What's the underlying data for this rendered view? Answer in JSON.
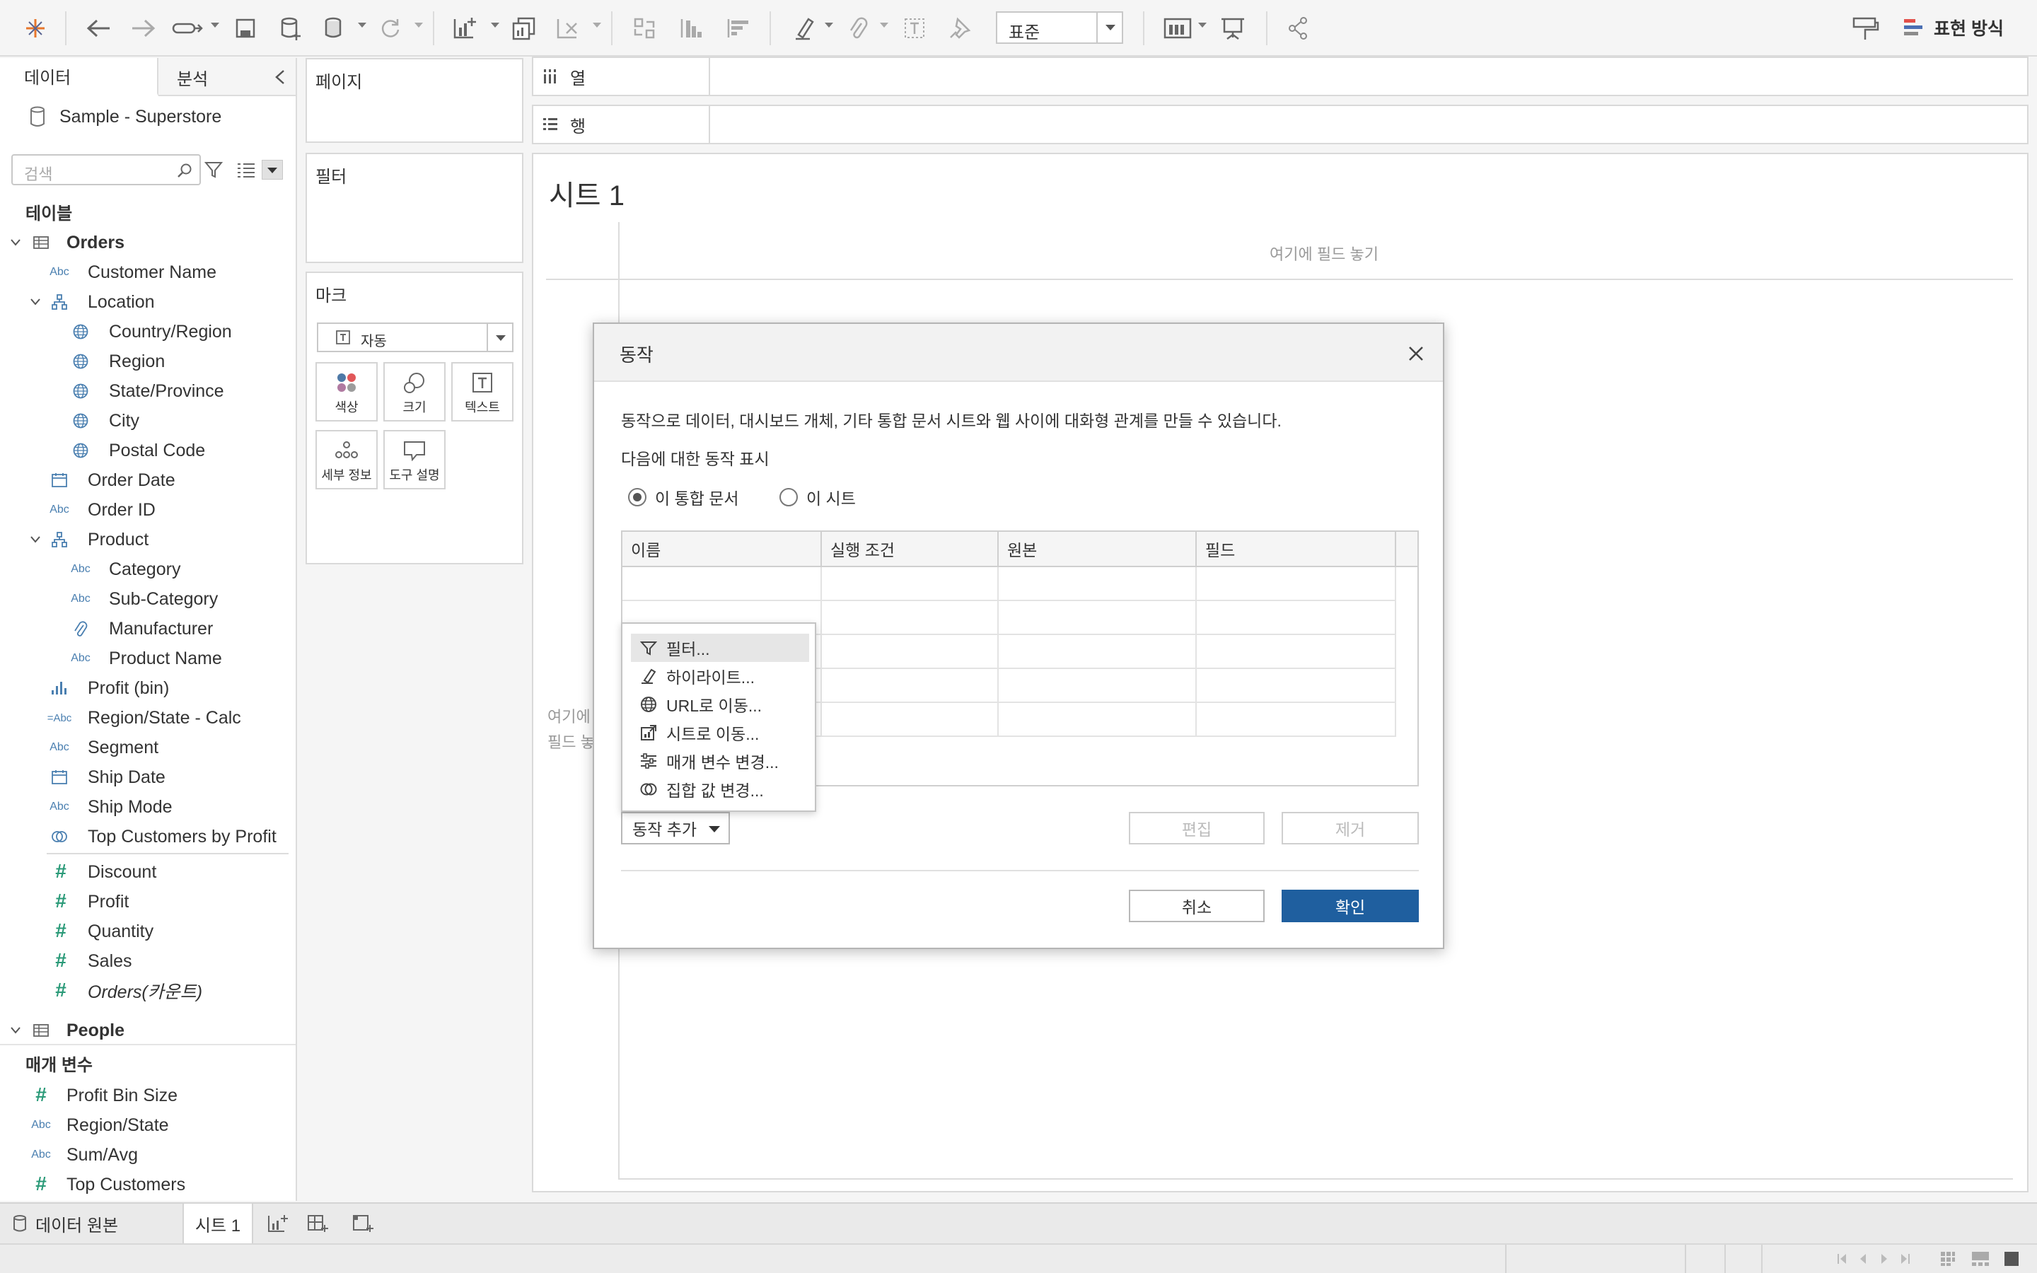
{
  "toolbar": {
    "fit_label": "표준",
    "show_me_label": "표현 방식"
  },
  "left_pane": {
    "tabs": [
      "데이터",
      "분석"
    ],
    "datasource": "Sample - Superstore",
    "search_placeholder": "검색",
    "tables_header": "테이블",
    "orders_table": "Orders",
    "fields": [
      {
        "label": "Customer Name",
        "icon": "Abc"
      },
      {
        "label": "Location",
        "icon": "hierarchy"
      },
      {
        "label": "Country/Region",
        "icon": "globe"
      },
      {
        "label": "Region",
        "icon": "globe"
      },
      {
        "label": "State/Province",
        "icon": "globe"
      },
      {
        "label": "City",
        "icon": "globe"
      },
      {
        "label": "Postal Code",
        "icon": "globe"
      },
      {
        "label": "Order Date",
        "icon": "calendar"
      },
      {
        "label": "Order ID",
        "icon": "Abc"
      },
      {
        "label": "Product",
        "icon": "hierarchy"
      },
      {
        "label": "Category",
        "icon": "Abc"
      },
      {
        "label": "Sub-Category",
        "icon": "Abc"
      },
      {
        "label": "Manufacturer",
        "icon": "paperclip"
      },
      {
        "label": "Product Name",
        "icon": "Abc"
      },
      {
        "label": "Profit (bin)",
        "icon": "bin"
      },
      {
        "label": "Region/State - Calc",
        "icon": "=Abc"
      },
      {
        "label": "Segment",
        "icon": "Abc"
      },
      {
        "label": "Ship Date",
        "icon": "calendar"
      },
      {
        "label": "Ship Mode",
        "icon": "Abc"
      },
      {
        "label": "Top Customers by Profit",
        "icon": "set"
      }
    ],
    "measures": [
      "Discount",
      "Profit",
      "Quantity",
      "Sales",
      "Orders(카운트)"
    ],
    "people_table": "People",
    "params_header": "매개 변수",
    "params": [
      {
        "label": "Profit Bin Size",
        "icon": "#"
      },
      {
        "label": "Region/State",
        "icon": "Abc"
      },
      {
        "label": "Sum/Avg",
        "icon": "Abc"
      },
      {
        "label": "Top Customers",
        "icon": "#"
      }
    ],
    "abc_text": "Abc",
    "calc_abc_text": "=Abc",
    "hash_text": "#"
  },
  "cards": {
    "pages": "페이지",
    "filters": "필터",
    "marks": "마크",
    "marks_type": "자동",
    "mark_buttons": [
      "색상",
      "크기",
      "텍스트",
      "세부 정보",
      "도구 설명"
    ]
  },
  "shelves": {
    "columns": "열",
    "rows": "행"
  },
  "sheet": {
    "title": "시트 1",
    "drop_top": "여기에 필드 놓기",
    "drop_left_1": "여기에",
    "drop_left_2": "필드 놓"
  },
  "bottom": {
    "datasource_tab": "데이터 원본",
    "sheet_tab": "시트 1"
  },
  "dialog": {
    "title": "동작",
    "description": "동작으로 데이터, 대시보드 개체, 기타 통합 문서 시트와 웹 사이에 대화형 관계를 만들 수 있습니다.",
    "show_actions_for": "다음에 대한 동작 표시",
    "radio_workbook": "이 통합 문서",
    "radio_sheet": "이 시트",
    "columns": [
      "이름",
      "실행 조건",
      "원본",
      "필드"
    ],
    "add_action": "동작 추가",
    "edit": "편집",
    "remove": "제거",
    "cancel": "취소",
    "ok": "확인"
  },
  "menu": {
    "items": [
      "필터...",
      "하이라이트...",
      "URL로 이동...",
      "시트로 이동...",
      "매개 변수 변경...",
      "집합 값 변경..."
    ]
  },
  "colors": {
    "primary_button": "#1f5f9f",
    "dimension_icon": "#4a7fb0",
    "measure_icon": "#2a9a78"
  }
}
